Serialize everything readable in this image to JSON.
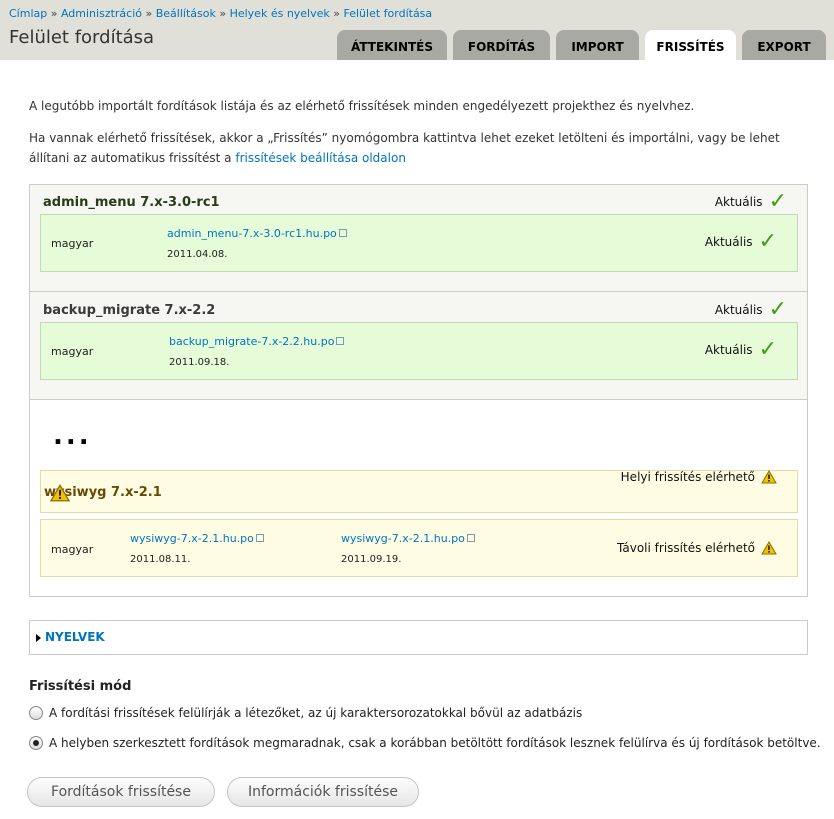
{
  "breadcrumb": {
    "items": [
      "Címlap",
      "Adminisztráció",
      "Beállítások",
      "Helyek és nyelvek",
      "Felület fordítása"
    ],
    "separator": "»"
  },
  "page_title": "Felület fordítása",
  "tabs": [
    {
      "label": "ÁTTEKINTÉS",
      "active": false
    },
    {
      "label": "FORDÍTÁS",
      "active": false
    },
    {
      "label": "IMPORT",
      "active": false
    },
    {
      "label": "FRISSÍTÉS",
      "active": true
    },
    {
      "label": "EXPORT",
      "active": false
    }
  ],
  "intro": {
    "line1": "A legutóbb importált fordítások listája és az elérhető frissítések minden engedélyezett projekthez és nyelvhez.",
    "line2_prefix": "Ha vannak elérhető frissítések, akkor a „Frissítés” nyomógombra kattintva lehet ezeket letölteni és importálni, vagy be lehet állítani az automatikus frissítést a ",
    "line2_link": "frissítések beállítása oldalon"
  },
  "projects": [
    {
      "title": "admin_menu 7.x-3.0-rc1",
      "status": "Aktuális",
      "rows": [
        {
          "language": "magyar",
          "file": "admin_menu-7.x-3.0-rc1.hu.po",
          "date": "2011.04.08.",
          "status": "Aktuális"
        }
      ]
    },
    {
      "title": "backup_migrate 7.x-2.2",
      "status": "Aktuális",
      "rows": [
        {
          "language": "magyar",
          "file": "backup_migrate-7.x-2.2.hu.po",
          "date": "2011.09.18.",
          "status": "Aktuális"
        }
      ]
    },
    {
      "title": "wysiwyg 7.x-2.1",
      "status": "Helyi frissítés elérhető",
      "rows": [
        {
          "language": "magyar",
          "file": "wysiwyg-7.x-2.1.hu.po",
          "date": "2011.08.11.",
          "file2": "wysiwyg-7.x-2.1.hu.po",
          "date2": "2011.09.19.",
          "status": "Távoli frissítés elérhető"
        }
      ]
    }
  ],
  "ellipsis": "...",
  "languages_label": "NYELVEK",
  "update_mode": {
    "title": "Frissítési mód",
    "options": [
      {
        "label": "A fordítási frissítések felülírják a létezőket, az új karaktersorozatokkal bővül az adatbázis",
        "checked": false
      },
      {
        "label": "A helyben szerkesztett fordítások megmaradnak, csak a korábban betöltött fordítások lesznek felülírva és új fordítások betöltve.",
        "checked": true
      }
    ]
  },
  "buttons": {
    "update_translations": "Fordítások frissítése",
    "update_info": "Információk frissítése"
  },
  "colors": {
    "link": "#0074bd",
    "ok_check": "#3da014",
    "row_green": "#e6fcd8",
    "row_yellow": "#fefde4",
    "warning": "#f2c200"
  },
  "icons": {
    "ok": "check-icon",
    "warning": "warning-icon",
    "external": "external-link-icon"
  }
}
